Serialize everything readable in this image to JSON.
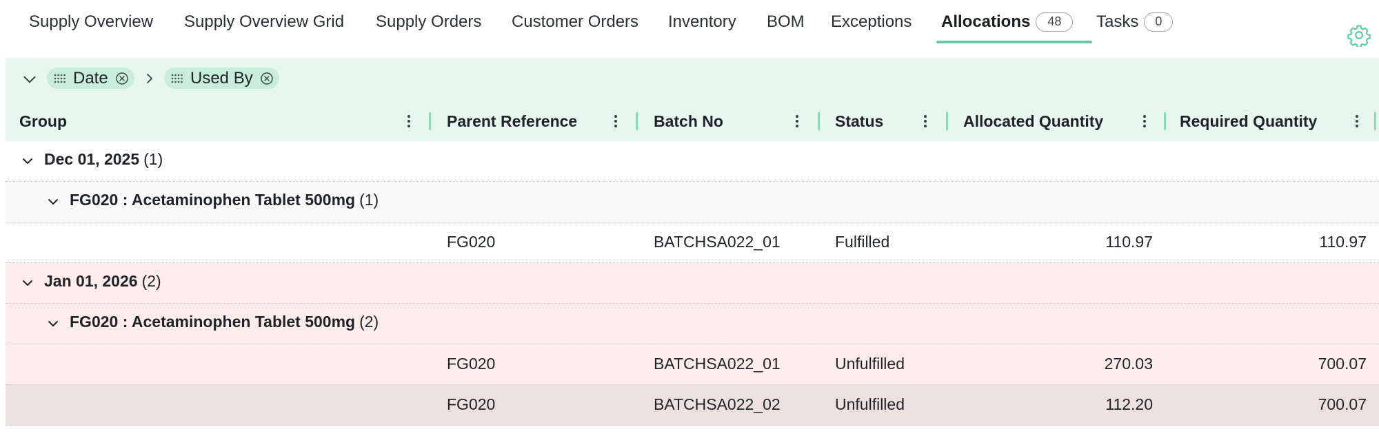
{
  "tabs": [
    {
      "label": "Supply Overview"
    },
    {
      "label": "Supply Overview Grid"
    },
    {
      "label": "Supply Orders"
    },
    {
      "label": "Customer Orders"
    },
    {
      "label": "Inventory"
    },
    {
      "label": "BOM"
    },
    {
      "label": "Exceptions"
    },
    {
      "label": "Allocations",
      "count": "48",
      "active": true
    },
    {
      "label": "Tasks",
      "count": "0"
    }
  ],
  "grouping": {
    "chips": [
      {
        "label": "Date"
      },
      {
        "label": "Used By"
      }
    ]
  },
  "columns": [
    {
      "label": "Group"
    },
    {
      "label": "Parent Reference"
    },
    {
      "label": "Batch No"
    },
    {
      "label": "Status"
    },
    {
      "label": "Allocated Quantity"
    },
    {
      "label": "Required Quantity"
    }
  ],
  "rows": [
    {
      "type": "group",
      "level": 1,
      "label": "Dec 01, 2025",
      "count": "(1)"
    },
    {
      "type": "group",
      "level": 2,
      "label": "FG020 : Acetaminophen Tablet 500mg",
      "count": "(1)"
    },
    {
      "type": "leaf",
      "parent_reference": "FG020",
      "batch_no": "BATCHSA022_01",
      "status": "Fulfilled",
      "allocated_quantity": "110.97",
      "required_quantity": "110.97"
    },
    {
      "type": "group",
      "level": 1,
      "label": "Jan 01, 2026",
      "count": "(2)"
    },
    {
      "type": "group",
      "level": 2,
      "label": "FG020 : Acetaminophen Tablet 500mg",
      "count": "(2)"
    },
    {
      "type": "leaf",
      "parent_reference": "FG020",
      "batch_no": "BATCHSA022_01",
      "status": "Unfulfilled",
      "allocated_quantity": "270.03",
      "required_quantity": "700.07"
    },
    {
      "type": "leaf",
      "parent_reference": "FG020",
      "batch_no": "BATCHSA022_02",
      "status": "Unfulfilled",
      "allocated_quantity": "112.20",
      "required_quantity": "700.07"
    }
  ],
  "colors": {
    "accent": "#5ecfa8",
    "header_bg": "#e7f6ef",
    "chip_bg": "#c9eddd",
    "overdue_bg": "#fdecec",
    "hover_bg": "#ece0e0"
  }
}
